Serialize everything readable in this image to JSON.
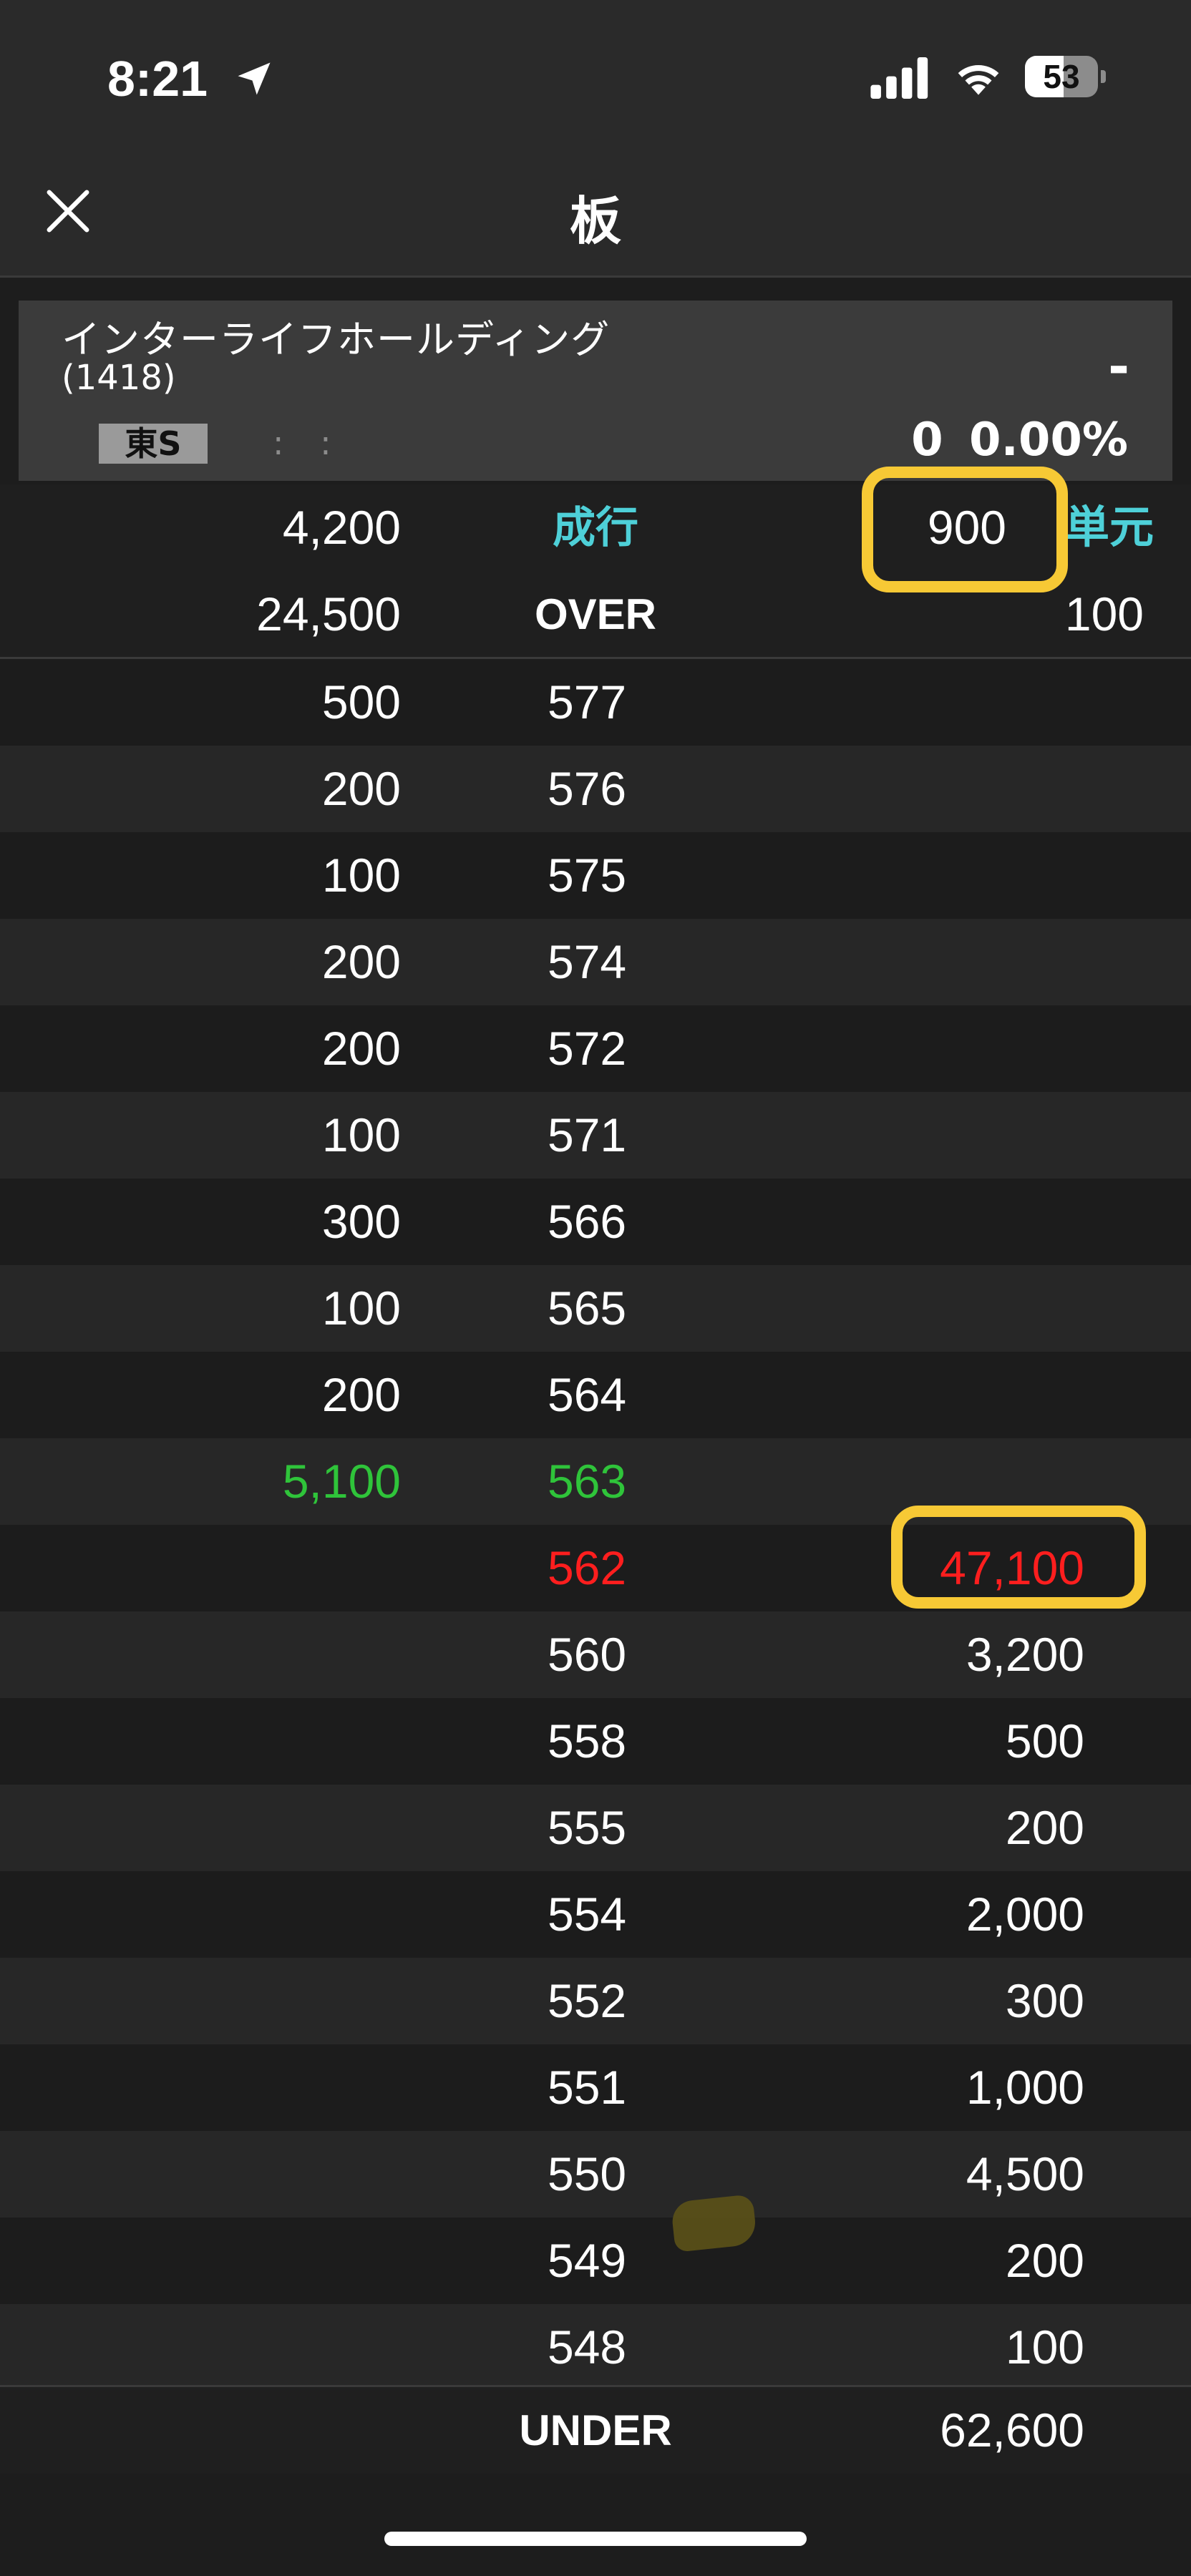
{
  "status_bar": {
    "time": "8:21",
    "battery": "53",
    "battery_level": 0.53
  },
  "nav": {
    "title": "板"
  },
  "stock": {
    "name": "インターライフホールディング",
    "code": "(1418)",
    "market": "東S",
    "time": ": :",
    "price": "-",
    "change": "0  0.00%"
  },
  "top_rows": {
    "market_order": {
      "sell": "4,200",
      "label": "成行",
      "buy": "900",
      "buy_label": "単元"
    },
    "over": {
      "sell": "24,500",
      "label": "OVER",
      "buy": "100"
    }
  },
  "book": [
    {
      "sell": "500",
      "price": "577",
      "buy": ""
    },
    {
      "sell": "200",
      "price": "576",
      "buy": ""
    },
    {
      "sell": "100",
      "price": "575",
      "buy": ""
    },
    {
      "sell": "200",
      "price": "574",
      "buy": ""
    },
    {
      "sell": "200",
      "price": "572",
      "buy": ""
    },
    {
      "sell": "100",
      "price": "571",
      "buy": ""
    },
    {
      "sell": "300",
      "price": "566",
      "buy": ""
    },
    {
      "sell": "100",
      "price": "565",
      "buy": ""
    },
    {
      "sell": "200",
      "price": "564",
      "buy": ""
    },
    {
      "sell": "5,100",
      "price": "563",
      "buy": ""
    },
    {
      "sell": "",
      "price": "562",
      "buy": "47,100"
    },
    {
      "sell": "",
      "price": "560",
      "buy": "3,200"
    },
    {
      "sell": "",
      "price": "558",
      "buy": "500"
    },
    {
      "sell": "",
      "price": "555",
      "buy": "200"
    },
    {
      "sell": "",
      "price": "554",
      "buy": "2,000"
    },
    {
      "sell": "",
      "price": "552",
      "buy": "300"
    },
    {
      "sell": "",
      "price": "551",
      "buy": "1,000"
    },
    {
      "sell": "",
      "price": "550",
      "buy": "4,500"
    },
    {
      "sell": "",
      "price": "549",
      "buy": "200"
    },
    {
      "sell": "",
      "price": "548",
      "buy": "100"
    }
  ],
  "under": {
    "label": "UNDER",
    "buy": "62,600"
  },
  "colors": {
    "best_ask": "#2fc43a",
    "best_bid": "#ff1e1e",
    "label_accent": "#4ed0d8",
    "highlight": "#f7c935"
  }
}
